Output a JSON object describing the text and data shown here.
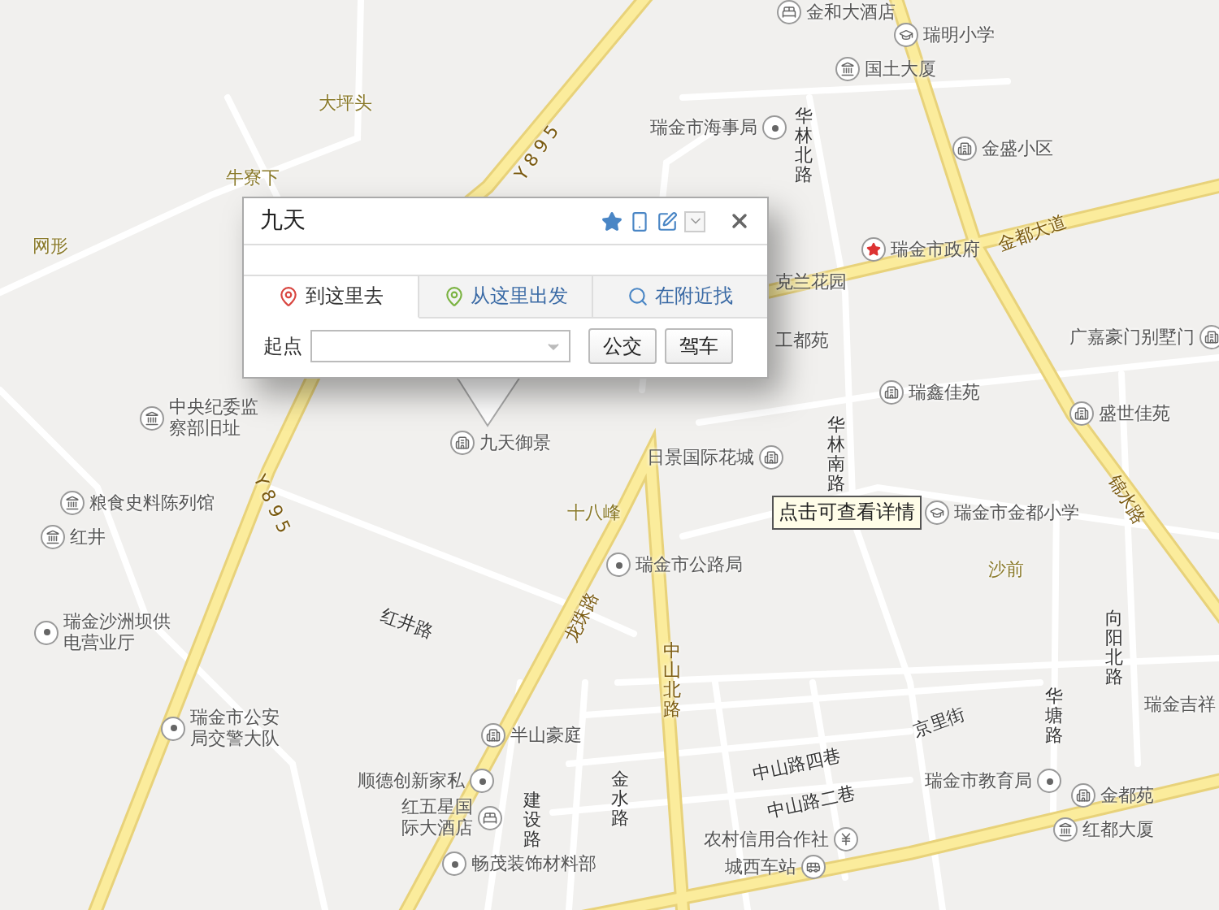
{
  "map": {
    "places": [
      {
        "name": "金和大酒店",
        "kind": "poi"
      },
      {
        "name": "瑞明小学",
        "kind": "poi"
      },
      {
        "name": "国土大厦",
        "kind": "poi"
      },
      {
        "name": "瑞金市海事局",
        "kind": "poi"
      },
      {
        "name": "华林北路",
        "kind": "road"
      },
      {
        "name": "金盛小区",
        "kind": "poi"
      },
      {
        "name": "金都大道",
        "kind": "highway"
      },
      {
        "name": "瑞金市政府",
        "kind": "poi"
      },
      {
        "name": "大坪头",
        "kind": "area"
      },
      {
        "name": "牛寮下",
        "kind": "area"
      },
      {
        "name": "网形",
        "kind": "area"
      },
      {
        "name": "克兰花园",
        "kind": "label"
      },
      {
        "name": "工都苑",
        "kind": "label"
      },
      {
        "name": "广嘉豪门别墅门",
        "kind": "poi"
      },
      {
        "name": "瑞鑫佳苑",
        "kind": "poi"
      },
      {
        "name": "盛世佳苑",
        "kind": "poi"
      },
      {
        "name": "中央纪委监察部旧址",
        "kind": "poi"
      },
      {
        "name": "九天御景",
        "kind": "poi"
      },
      {
        "name": "日景国际花城",
        "kind": "poi"
      },
      {
        "name": "华林南路",
        "kind": "road"
      },
      {
        "name": "十八峰",
        "kind": "area"
      },
      {
        "name": "粮食史料陈列馆",
        "kind": "poi"
      },
      {
        "name": "红井",
        "kind": "poi"
      },
      {
        "name": "瑞金沙洲坝供电营业厅",
        "kind": "poi"
      },
      {
        "name": "瑞金市公路局",
        "kind": "poi"
      },
      {
        "name": "瑞金市金都小学",
        "kind": "poi"
      },
      {
        "name": "沙前",
        "kind": "area"
      },
      {
        "name": "锦水路",
        "kind": "highway"
      },
      {
        "name": "红井路",
        "kind": "road"
      },
      {
        "name": "龙珠路",
        "kind": "highway"
      },
      {
        "name": "中山北路",
        "kind": "highway"
      },
      {
        "name": "向阳北路",
        "kind": "road"
      },
      {
        "name": "京里街",
        "kind": "road"
      },
      {
        "name": "华塘路",
        "kind": "road"
      },
      {
        "name": "瑞金吉祥",
        "kind": "label"
      },
      {
        "name": "瑞金市公安局交警大队",
        "kind": "poi"
      },
      {
        "name": "半山豪庭",
        "kind": "poi"
      },
      {
        "name": "顺德创新家私",
        "kind": "poi"
      },
      {
        "name": "红五星国际大酒店",
        "kind": "poi"
      },
      {
        "name": "建设路",
        "kind": "road"
      },
      {
        "name": "金水路",
        "kind": "road"
      },
      {
        "name": "中山路四巷",
        "kind": "road"
      },
      {
        "name": "中山路二巷",
        "kind": "road"
      },
      {
        "name": "瑞金市教育局",
        "kind": "poi"
      },
      {
        "name": "金都苑",
        "kind": "poi"
      },
      {
        "name": "红都大厦",
        "kind": "poi"
      },
      {
        "name": "畅茂装饰材料部",
        "kind": "poi"
      },
      {
        "name": "农村信用合作社",
        "kind": "poi"
      },
      {
        "name": "城西车站",
        "kind": "poi"
      },
      {
        "name": "Y 8 9 5",
        "kind": "highway"
      },
      {
        "name": "Y 8 9 5",
        "kind": "highway"
      }
    ],
    "tooltip": "点击可查看详情"
  },
  "popup": {
    "title": "九天",
    "tabs": [
      {
        "label": "到这里去",
        "selected": true
      },
      {
        "label": "从这里出发",
        "selected": false
      },
      {
        "label": "在附近找",
        "selected": false
      }
    ],
    "start_label": "起点",
    "buttons": [
      "公交",
      "驾车"
    ]
  }
}
